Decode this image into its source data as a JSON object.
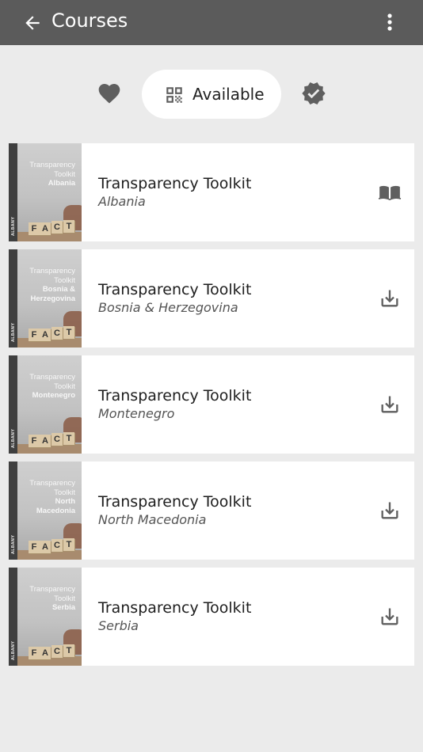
{
  "appbar": {
    "title": "Courses",
    "back_icon": "arrow-back-icon",
    "menu_icon": "more-vert-icon"
  },
  "filters": {
    "favorites_icon": "heart-icon",
    "available_icon": "qr-code-icon",
    "available_label": "Available",
    "completed_icon": "verified-badge-icon"
  },
  "colors": {
    "appbar": "#5b5b5b",
    "background": "#ebebeb",
    "icon": "#5f5f5f"
  },
  "courses": [
    {
      "title": "Transparency Toolkit",
      "subtitle": "Albania",
      "cover_line1": "Transparency",
      "cover_line2": "Toolkit",
      "cover_country": "Albania",
      "cover_word": "FACT",
      "cover_brand": "ALBANY",
      "action_icon": "open-book-icon"
    },
    {
      "title": "Transparency Toolkit",
      "subtitle": "Bosnia & Herzegovina",
      "cover_line1": "Transparency",
      "cover_line2": "Toolkit",
      "cover_country": "Bosnia & Herzegovina",
      "cover_word": "FACT",
      "cover_brand": "ALBANY",
      "action_icon": "download-icon"
    },
    {
      "title": "Transparency Toolkit",
      "subtitle": "Montenegro",
      "cover_line1": "Transparency",
      "cover_line2": "Toolkit",
      "cover_country": "Montenegro",
      "cover_word": "FACT",
      "cover_brand": "ALBANY",
      "action_icon": "download-icon"
    },
    {
      "title": "Transparency Toolkit",
      "subtitle": "North Macedonia",
      "cover_line1": "Transparency",
      "cover_line2": "Toolkit",
      "cover_country": "North Macedonia",
      "cover_word": "FACT",
      "cover_brand": "ALBANY",
      "action_icon": "download-icon"
    },
    {
      "title": "Transparency Toolkit",
      "subtitle": "Serbia",
      "cover_line1": "Transparency",
      "cover_line2": "Toolkit",
      "cover_country": "Serbia",
      "cover_word": "FACT",
      "cover_brand": "ALBANY",
      "action_icon": "download-icon"
    }
  ]
}
